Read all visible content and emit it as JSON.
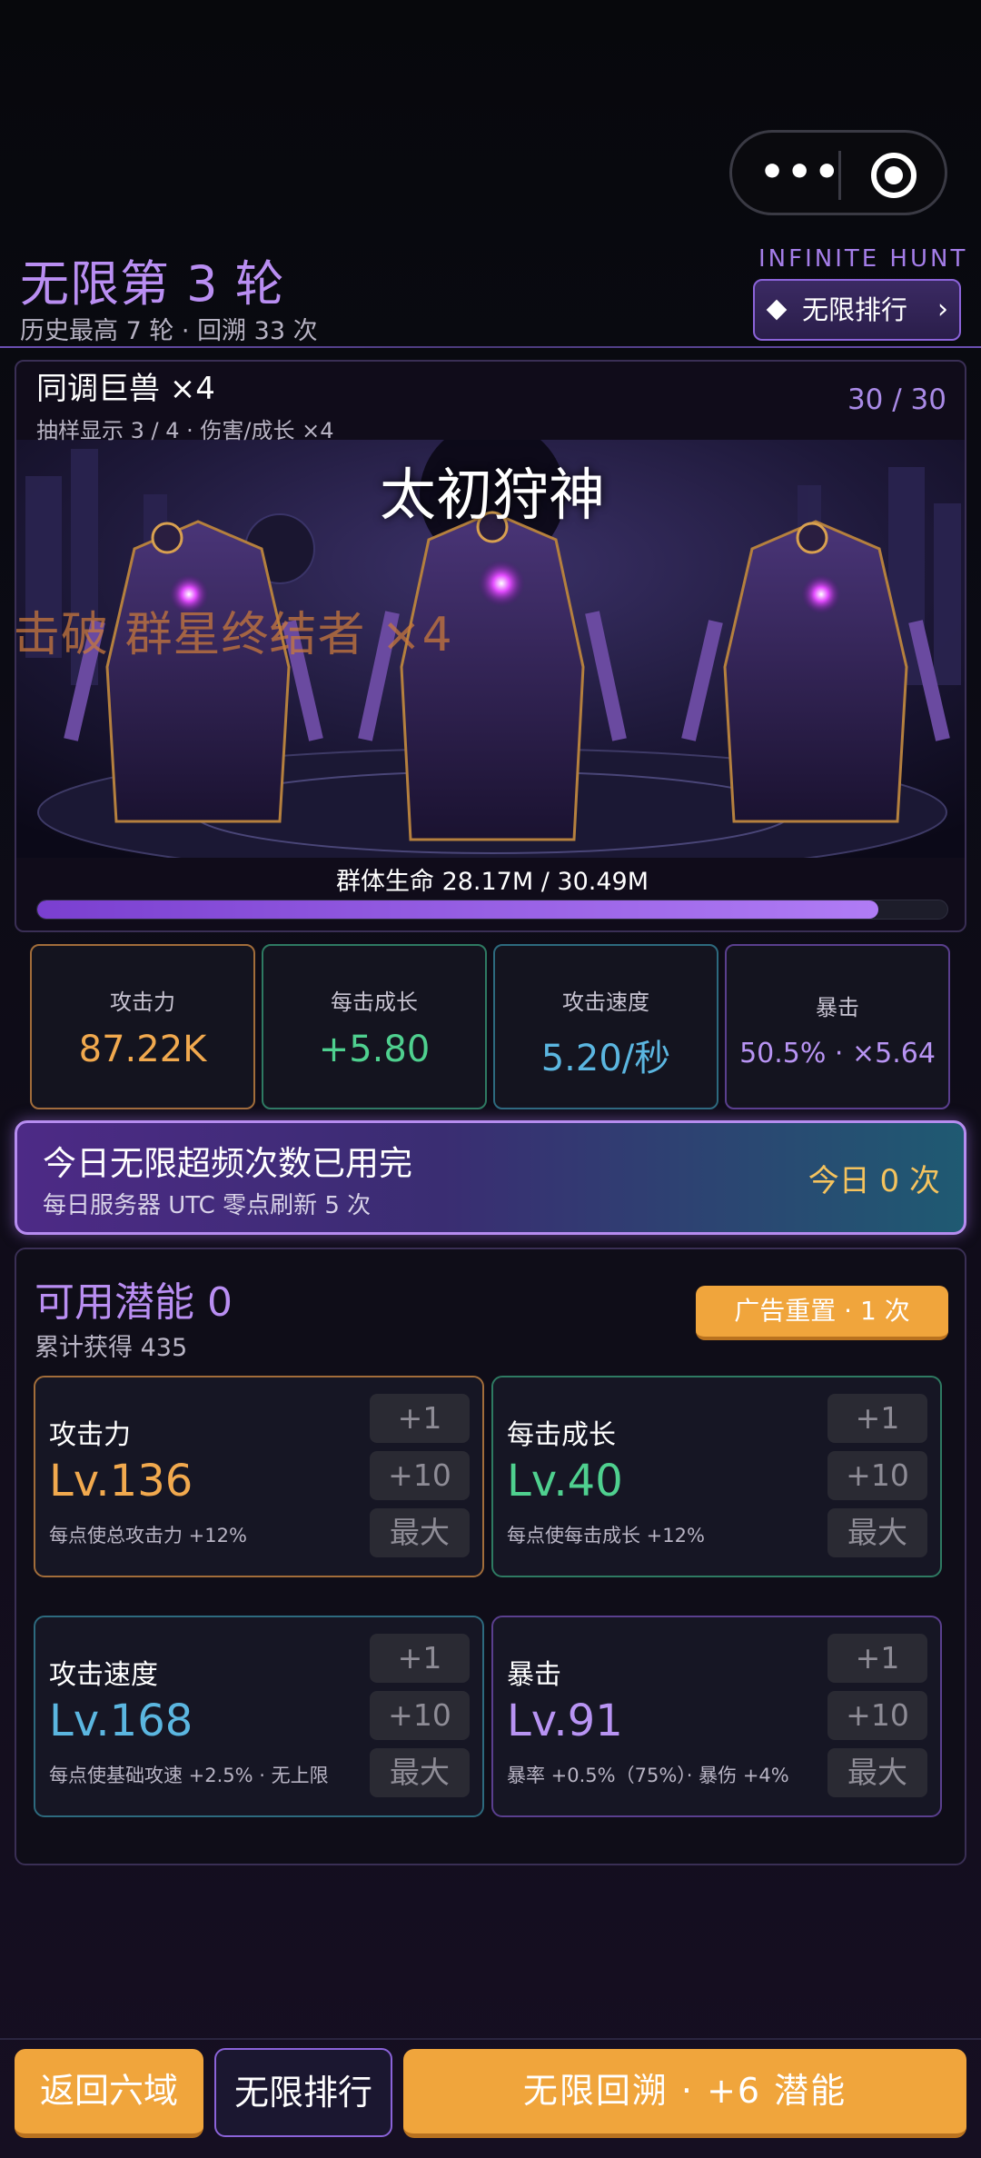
{
  "header": {
    "round_title": "无限第 3 轮",
    "history": "历史最高 7 轮 · 回溯 33 次",
    "brand": "INFINITE HUNT",
    "rank_button": "无限排行"
  },
  "capsule": {
    "more_glyph": "•••"
  },
  "boss": {
    "group_name": "同调巨兽 ×4",
    "sample_info": "抽样显示 3 / 4 · 伤害/成长 ×4",
    "count": "30 / 30",
    "title": "太初狩神",
    "defeat_text": "击破 群星终结者 ×4",
    "hp_text": "群体生命 28.17M / 30.49M",
    "hp_fraction": 0.9238
  },
  "stats": [
    {
      "label": "攻击力",
      "value": "87.22K"
    },
    {
      "label": "每击成长",
      "value": "+5.80"
    },
    {
      "label": "攻击速度",
      "value": "5.20/秒"
    },
    {
      "label": "暴击",
      "value": "50.5% · ×5.64"
    }
  ],
  "overclock": {
    "title": "今日无限超频次数已用完",
    "subtitle": "每日服务器 UTC 零点刷新 5 次",
    "today": "今日 0 次"
  },
  "potential": {
    "title": "可用潜能 0",
    "total": "累计获得 435",
    "ad_reset": "广告重置 · 1 次",
    "buttons": {
      "plus1": "+1",
      "plus10": "+10",
      "max": "最大"
    },
    "cards": [
      {
        "name": "攻击力",
        "level": "Lv.136",
        "desc": "每点使总攻击力 +12%"
      },
      {
        "name": "每击成长",
        "level": "Lv.40",
        "desc": "每点使每击成长 +12%"
      },
      {
        "name": "攻击速度",
        "level": "Lv.168",
        "desc": "每点使基础攻速 +2.5% · 无上限"
      },
      {
        "name": "暴击",
        "level": "Lv.91",
        "desc": "暴率 +0.5%（75%）· 暴伤 +4%"
      }
    ]
  },
  "bottom": {
    "back": "返回六域",
    "rank": "无限排行",
    "retro": "无限回溯 · +6 潜能"
  },
  "colors": {
    "accent_purple": "#b98ef2",
    "orange": "#f0a53c",
    "green": "#4fd08f",
    "blue": "#5bb6e0"
  }
}
